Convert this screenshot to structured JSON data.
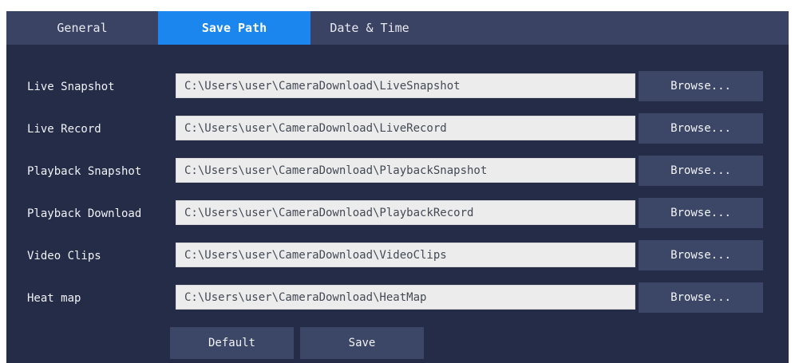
{
  "tabs": [
    {
      "label": "General",
      "active": false
    },
    {
      "label": "Save Path",
      "active": true
    },
    {
      "label": "Date & Time",
      "active": false
    }
  ],
  "paths": [
    {
      "label": "Live Snapshot",
      "value": "C:\\Users\\user\\CameraDownload\\LiveSnapshot",
      "browse": "Browse..."
    },
    {
      "label": "Live Record",
      "value": "C:\\Users\\user\\CameraDownload\\LiveRecord",
      "browse": "Browse..."
    },
    {
      "label": "Playback Snapshot",
      "value": "C:\\Users\\user\\CameraDownload\\PlaybackSnapshot",
      "browse": "Browse..."
    },
    {
      "label": "Playback Download",
      "value": "C:\\Users\\user\\CameraDownload\\PlaybackRecord",
      "browse": "Browse..."
    },
    {
      "label": "Video Clips",
      "value": "C:\\Users\\user\\CameraDownload\\VideoClips",
      "browse": "Browse..."
    },
    {
      "label": "Heat map",
      "value": "C:\\Users\\user\\CameraDownload\\HeatMap",
      "browse": "Browse..."
    }
  ],
  "actions": {
    "default_label": "Default",
    "save_label": "Save"
  },
  "colors": {
    "panel_bg": "#252c48",
    "tab_bar_bg": "#3a4363",
    "active_tab": "#1b87ee",
    "button_bg": "#3c4666",
    "field_bg": "#ececec"
  }
}
